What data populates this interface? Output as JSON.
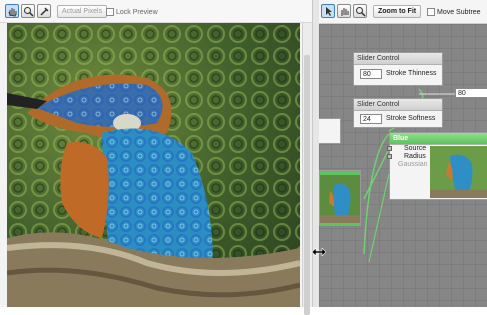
{
  "toolbar": {
    "actual_pixels_label": "Actual Pixels",
    "lock_preview_label": "Lock Preview"
  },
  "graph_toolbar": {
    "zoom_to_fit_label": "Zoom to Fit",
    "move_subtree_label": "Move Subtree"
  },
  "nodes": {
    "slider1": {
      "title": "Slider Control",
      "value": "80",
      "param": "Stroke Thinness"
    },
    "slider2": {
      "title": "Slider Control",
      "value": "24",
      "param": "Stroke Softness"
    },
    "blue": {
      "title": "Blue",
      "inputs": [
        "Source",
        "Radius",
        "Gaussian"
      ]
    },
    "offscreen_value": "80"
  },
  "colors": {
    "accent": "#3c7fc2",
    "node_green": "#6fd26f",
    "wire_green": "#2dbb2d"
  },
  "icons": [
    "hand-icon",
    "zoom-icon",
    "eyedropper-icon"
  ]
}
